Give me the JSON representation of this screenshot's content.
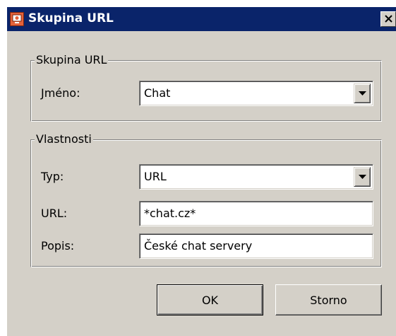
{
  "window": {
    "title": "Skupina URL",
    "icon": "app-icon",
    "close_icon": "close-icon",
    "colors": {
      "titlebar": "#0a246a",
      "face": "#d4d0c8",
      "field": "#ffffff"
    }
  },
  "group_url": {
    "legend": "Skupina URL",
    "name_label": "Jméno:",
    "name_value": "Chat"
  },
  "properties": {
    "legend": "Vlastnosti",
    "type_label": "Typ:",
    "type_value": "URL",
    "url_label": "URL:",
    "url_value": "*chat.cz*",
    "desc_label": "Popis:",
    "desc_value": "České chat servery"
  },
  "buttons": {
    "ok": "OK",
    "cancel": "Storno"
  }
}
